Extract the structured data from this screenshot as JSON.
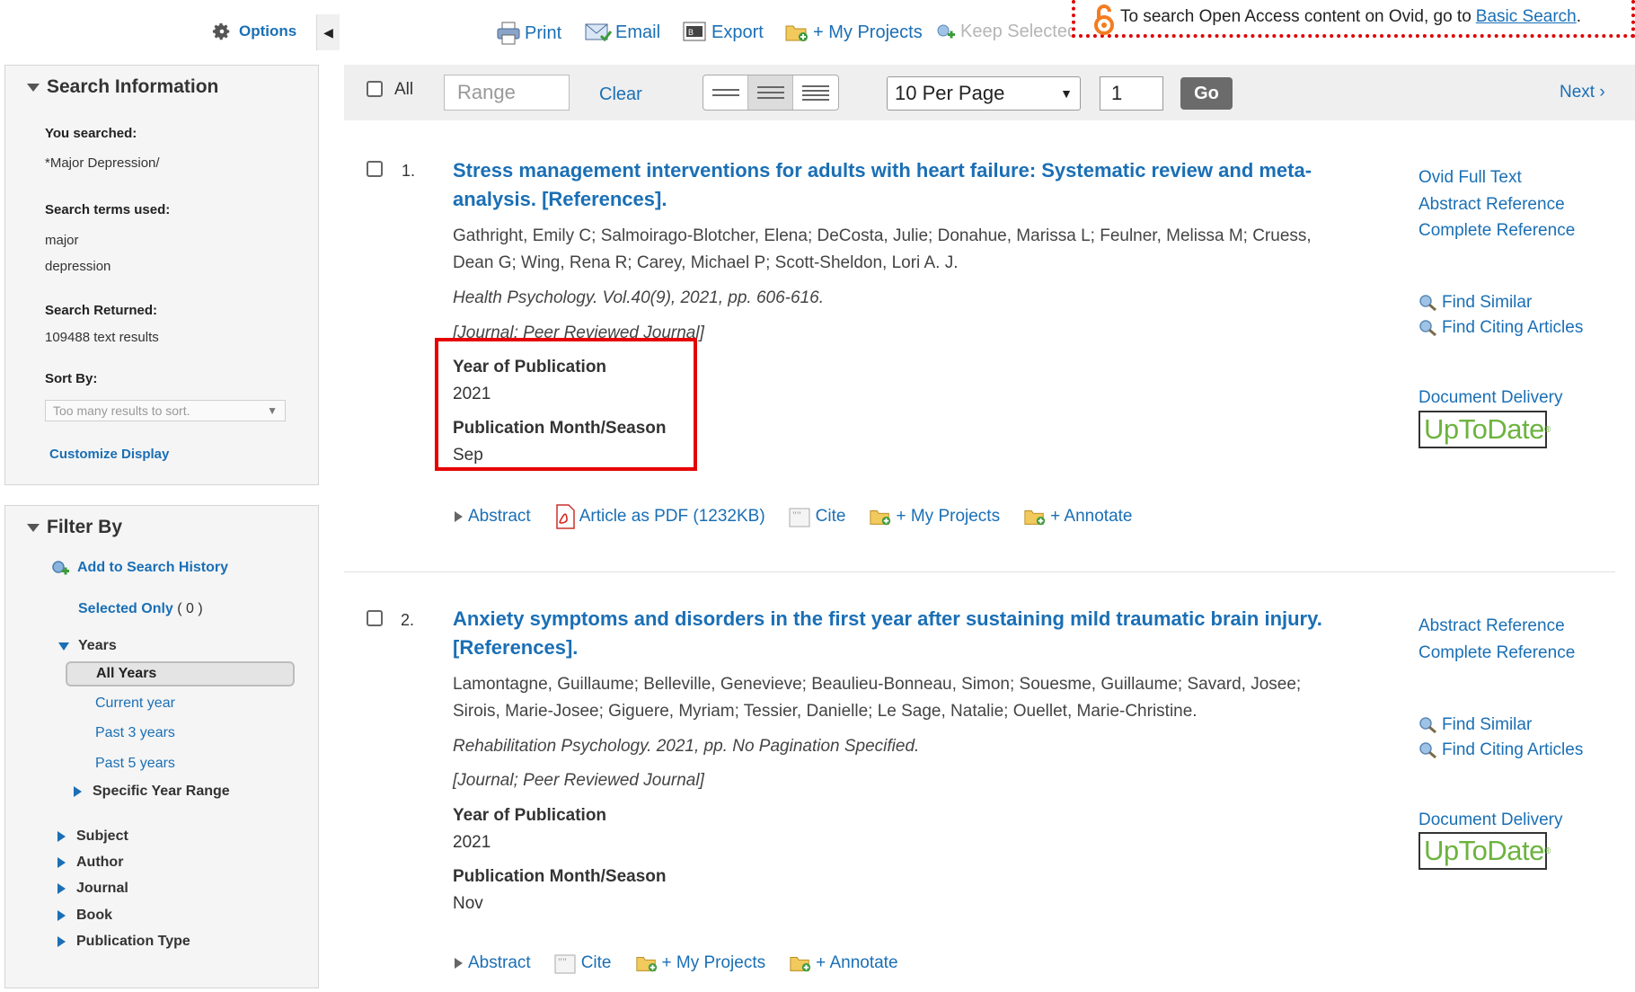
{
  "sidebar": {
    "options_label": "Options",
    "search_info": {
      "title": "Search Information",
      "you_searched_label": "You searched:",
      "you_searched_value": "*Major Depression/",
      "terms_label": "Search terms used:",
      "terms": [
        "major",
        "depression"
      ],
      "returned_label": "Search Returned:",
      "returned_value": "109488 text results",
      "sort_label": "Sort By:",
      "sort_value": "Too many results to sort.",
      "customize_label": "Customize Display"
    },
    "filter": {
      "title": "Filter By",
      "add_history": "Add to Search History",
      "selected_only": "Selected Only",
      "selected_count": "( 0 )",
      "years_label": "Years",
      "year_options": [
        "All Years",
        "Current year",
        "Past 3 years",
        "Past 5 years"
      ],
      "specific_range": "Specific Year Range",
      "facets": [
        "Subject",
        "Author",
        "Journal",
        "Book",
        "Publication Type"
      ]
    }
  },
  "toolbar": {
    "print": "Print",
    "email": "Email",
    "export": "Export",
    "my_projects": "+ My Projects",
    "keep_selected": "Keep Selected",
    "open_access_text": "To search Open Access content on Ovid, go to",
    "open_access_link": "Basic Search",
    "open_access_end": "."
  },
  "results_bar": {
    "all_label": "All",
    "range_placeholder": "Range",
    "clear_label": "Clear",
    "per_page": "10 Per Page",
    "page": "1",
    "go_label": "Go",
    "next_label": "Next ›"
  },
  "results": [
    {
      "number": "1.",
      "title_line1": "Stress management interventions for adults with heart failure: Systematic review and meta-",
      "title_line2": "analysis. [References].",
      "authors_line1": "Gathright, Emily C; Salmoirago-Blotcher, Elena; DeCosta, Julie; Donahue, Marissa L; Feulner, Melissa M; Cruess,",
      "authors_line2": "Dean G; Wing, Rena R; Carey, Michael P; Scott-Sheldon, Lori A. J.",
      "source": "Health Psychology. Vol.40(9), 2021, pp. 606-616.",
      "pub_type": "[Journal; Peer Reviewed Journal]",
      "year_label": "Year of Publication",
      "year_value": "2021",
      "month_label": "Publication Month/Season",
      "month_value": "Sep",
      "actions": [
        "Abstract",
        "Article as PDF (1232KB)",
        "Cite",
        "+ My Projects",
        "+ Annotate"
      ],
      "side_links": [
        "Ovid Full Text",
        "Abstract Reference",
        "Complete Reference",
        "Find Similar",
        "Find Citing Articles",
        "Document Delivery"
      ],
      "uptodate": "UpToDate"
    },
    {
      "number": "2.",
      "title_line1": "Anxiety symptoms and disorders in the first year after sustaining mild traumatic brain injury.",
      "title_line2": "[References].",
      "authors_line1": "Lamontagne, Guillaume; Belleville, Genevieve; Beaulieu-Bonneau, Simon; Souesme, Guillaume; Savard, Josee;",
      "authors_line2": "Sirois, Marie-Josee; Giguere, Myriam; Tessier, Danielle; Le Sage, Natalie; Ouellet, Marie-Christine.",
      "source": "Rehabilitation Psychology. 2021, pp. No Pagination Specified.",
      "pub_type": "[Journal; Peer Reviewed Journal]",
      "year_label": "Year of Publication",
      "year_value": "2021",
      "month_label": "Publication Month/Season",
      "month_value": "Nov",
      "actions": [
        "Abstract",
        "Cite",
        "+ My Projects",
        "+ Annotate"
      ],
      "side_links": [
        "Abstract Reference",
        "Complete Reference",
        "Find Similar",
        "Find Citing Articles",
        "Document Delivery"
      ],
      "uptodate": "UpToDate"
    }
  ],
  "colors": {
    "link": "#1a6fb5",
    "highlight_border": "#e60000",
    "oa_border": "#e00000",
    "uptodate_green": "#6db33f"
  }
}
